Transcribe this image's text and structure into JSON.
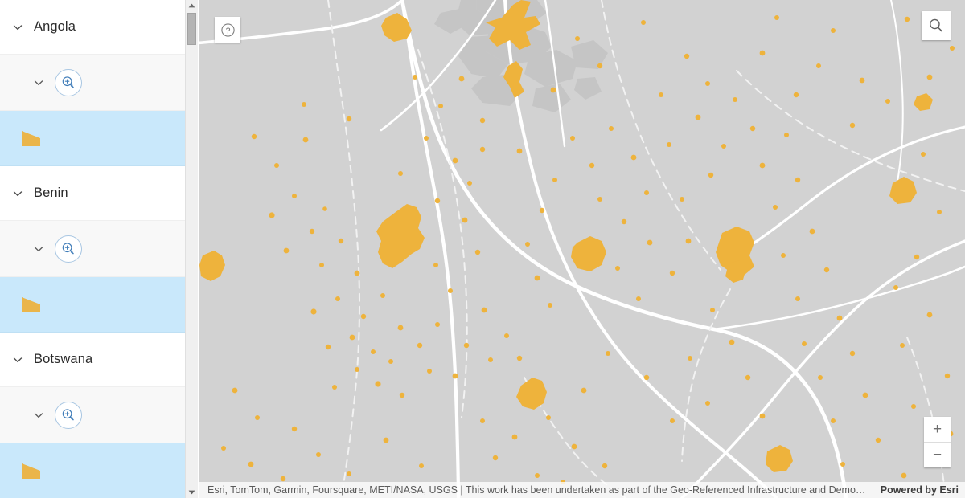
{
  "sidebar": {
    "groups": [
      {
        "name": "Angola",
        "collapse_icon": "chevron-down-icon",
        "sub_collapse_icon": "chevron-down-icon",
        "zoom_to_icon": "magnifier-plus-icon",
        "legend_swatch": "polygon-swatch",
        "legend_color": "#eab54a",
        "legend_row_color": "#c9e8fb"
      },
      {
        "name": "Benin",
        "collapse_icon": "chevron-down-icon",
        "sub_collapse_icon": "chevron-down-icon",
        "zoom_to_icon": "magnifier-plus-icon",
        "legend_swatch": "polygon-swatch",
        "legend_color": "#eab54a",
        "legend_row_color": "#c9e8fb"
      },
      {
        "name": "Botswana",
        "collapse_icon": "chevron-down-icon",
        "sub_collapse_icon": "chevron-down-icon",
        "zoom_to_icon": "magnifier-plus-icon",
        "legend_swatch": "polygon-swatch",
        "legend_color": "#eab54a",
        "legend_row_color": "#c9e8fb"
      }
    ],
    "scrollbar": {
      "up_arrow_icon": "triangle-up-icon",
      "down_arrow_icon": "triangle-down-icon"
    }
  },
  "map": {
    "help_button": {
      "icon": "question-mark-circle-icon",
      "label": "?"
    },
    "search_button": {
      "icon": "search-icon"
    },
    "zoom_in": {
      "label": "+",
      "icon": "plus-icon"
    },
    "zoom_out": {
      "label": "−",
      "icon": "minus-icon"
    },
    "attribution": "Esri, TomTom, Garmin, Foursquare, METI/NASA, USGS | This work has been undertaken as part of the Geo-Referenced Infrastructure and Demographi…",
    "powered_by": "Powered by Esri",
    "colors": {
      "basemap": "#d2d2d2",
      "urban_shade": "#c4c4c4",
      "roads": "#ffffff",
      "feature": "#eeb33c"
    }
  }
}
